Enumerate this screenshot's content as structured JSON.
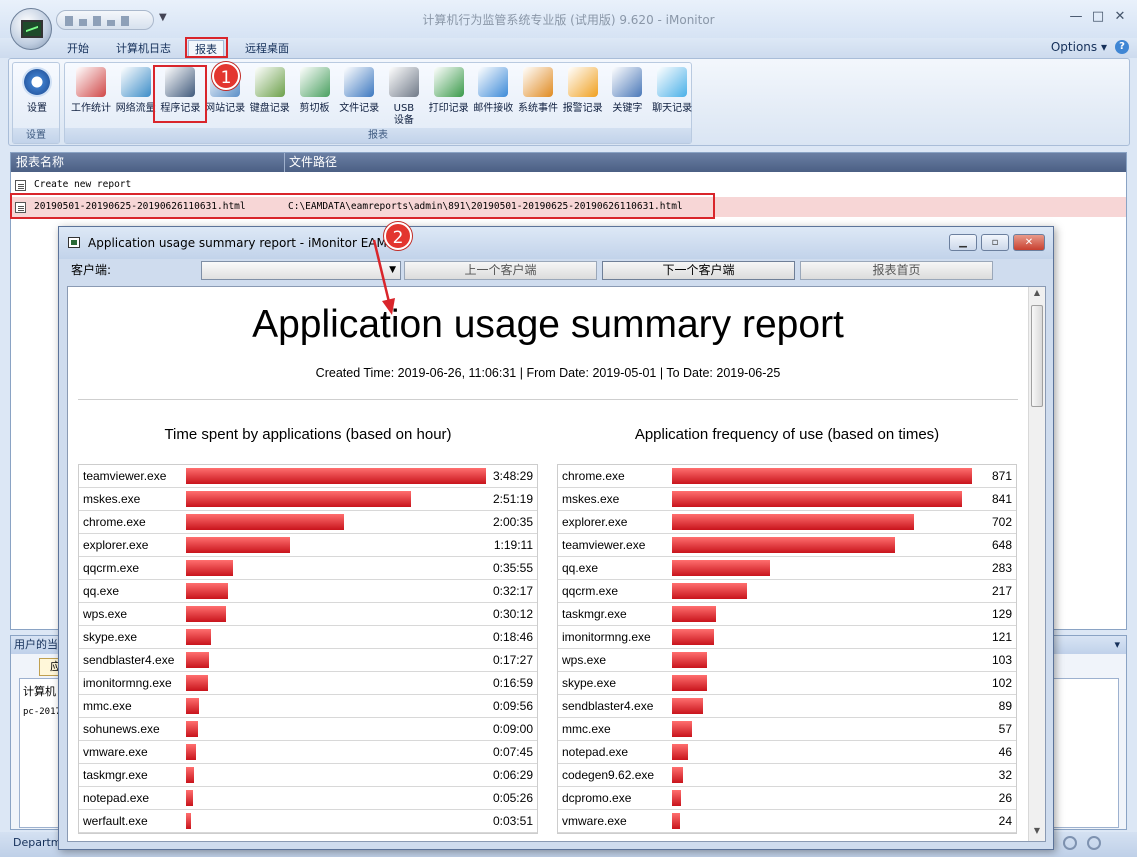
{
  "window": {
    "title": "计算机行为监管系统专业版 (试用版) 9.620 - iMonitor"
  },
  "ribbon_tabs": [
    "开始",
    "计算机日志",
    "报表",
    "远程桌面"
  ],
  "options_label": "Options",
  "settings_group": {
    "button": "设置",
    "label": "设置"
  },
  "report_group": {
    "label": "报表",
    "buttons": [
      "工作统计",
      "网络流量",
      "程序记录",
      "网站记录",
      "键盘记录",
      "剪切板",
      "文件记录",
      "USB\n设备",
      "打印记录",
      "邮件接收",
      "系统事件",
      "报警记录",
      "关键字",
      "聊天记录"
    ]
  },
  "report_list": {
    "columns": [
      "报表名称",
      "文件路径"
    ],
    "rows": [
      {
        "name": "Create new report",
        "path": ""
      },
      {
        "name": "20190501-20190625-20190626110631.html",
        "path": "C:\\EAMDATA\\eamreports\\admin\\891\\20190501-20190625-20190626110631.html"
      }
    ]
  },
  "lower_panel": {
    "title": "用户的当",
    "tab": "应用",
    "col": "计算机",
    "cell": "pc-2017"
  },
  "status": {
    "text": "Departm"
  },
  "badges": [
    "1",
    "2"
  ],
  "report_window": {
    "title": "Application usage summary report - iMonitor EAM",
    "client_label": "客户端:",
    "buttons": [
      "上一个客户端",
      "下一个客户端",
      "报表首页"
    ],
    "report_title": "Application usage summary report",
    "meta": "Created Time: 2019-06-26, 11:06:31 | From Date: 2019-05-01 | To Date: 2019-06-25",
    "time_title": "Time spent by applications (based on hour)",
    "freq_title": "Application frequency of use (based on times)",
    "time_rows": [
      {
        "name": "teamviewer.exe",
        "value": "3:48:29",
        "fraction": 1.0
      },
      {
        "name": "mskes.exe",
        "value": "2:51:19",
        "fraction": 0.75
      },
      {
        "name": "chrome.exe",
        "value": "2:00:35",
        "fraction": 0.527
      },
      {
        "name": "explorer.exe",
        "value": "1:19:11",
        "fraction": 0.347
      },
      {
        "name": "qqcrm.exe",
        "value": "0:35:55",
        "fraction": 0.157
      },
      {
        "name": "qq.exe",
        "value": "0:32:17",
        "fraction": 0.141
      },
      {
        "name": "wps.exe",
        "value": "0:30:12",
        "fraction": 0.132
      },
      {
        "name": "skype.exe",
        "value": "0:18:46",
        "fraction": 0.082
      },
      {
        "name": "sendblaster4.exe",
        "value": "0:17:27",
        "fraction": 0.076
      },
      {
        "name": "imonitormng.exe",
        "value": "0:16:59",
        "fraction": 0.074
      },
      {
        "name": "mmc.exe",
        "value": "0:09:56",
        "fraction": 0.043
      },
      {
        "name": "sohunews.exe",
        "value": "0:09:00",
        "fraction": 0.039
      },
      {
        "name": "vmware.exe",
        "value": "0:07:45",
        "fraction": 0.034
      },
      {
        "name": "taskmgr.exe",
        "value": "0:06:29",
        "fraction": 0.028
      },
      {
        "name": "notepad.exe",
        "value": "0:05:26",
        "fraction": 0.024
      },
      {
        "name": "werfault.exe",
        "value": "0:03:51",
        "fraction": 0.017
      }
    ],
    "freq_rows": [
      {
        "name": "chrome.exe",
        "value": "871",
        "fraction": 1.0
      },
      {
        "name": "mskes.exe",
        "value": "841",
        "fraction": 0.966
      },
      {
        "name": "explorer.exe",
        "value": "702",
        "fraction": 0.806
      },
      {
        "name": "teamviewer.exe",
        "value": "648",
        "fraction": 0.744
      },
      {
        "name": "qq.exe",
        "value": "283",
        "fraction": 0.325
      },
      {
        "name": "qqcrm.exe",
        "value": "217",
        "fraction": 0.249
      },
      {
        "name": "taskmgr.exe",
        "value": "129",
        "fraction": 0.148
      },
      {
        "name": "imonitormng.exe",
        "value": "121",
        "fraction": 0.139
      },
      {
        "name": "wps.exe",
        "value": "103",
        "fraction": 0.118
      },
      {
        "name": "skype.exe",
        "value": "102",
        "fraction": 0.117
      },
      {
        "name": "sendblaster4.exe",
        "value": "89",
        "fraction": 0.102
      },
      {
        "name": "mmc.exe",
        "value": "57",
        "fraction": 0.065
      },
      {
        "name": "notepad.exe",
        "value": "46",
        "fraction": 0.053
      },
      {
        "name": "codegen9.62.exe",
        "value": "32",
        "fraction": 0.037
      },
      {
        "name": "dcpromo.exe",
        "value": "26",
        "fraction": 0.03
      },
      {
        "name": "vmware.exe",
        "value": "24",
        "fraction": 0.028
      }
    ]
  },
  "colors": {
    "bar": "#c8141c",
    "highlight": "#d9252b",
    "list_header": "#4b5f84"
  }
}
